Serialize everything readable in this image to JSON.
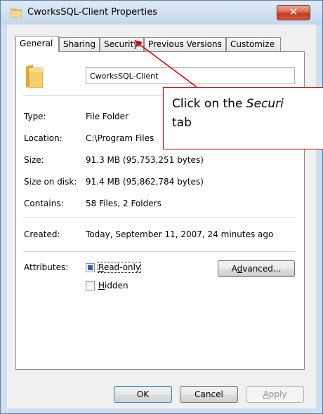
{
  "window": {
    "title": "CworksSQL-Client Properties",
    "close_glyph": "✕",
    "accent": "#c23a21"
  },
  "tabs": [
    {
      "label": "General"
    },
    {
      "label": "Sharing"
    },
    {
      "label": "Security"
    },
    {
      "label": "Previous Versions"
    },
    {
      "label": "Customize"
    }
  ],
  "general": {
    "folder_name": "CworksSQL-Client",
    "rows": [
      {
        "label": "Type:",
        "value": "File Folder"
      },
      {
        "label": "Location:",
        "value": "C:\\Program Files"
      },
      {
        "label": "Size:",
        "value": "91.3 MB (95,753,251 bytes)"
      },
      {
        "label": "Size on disk:",
        "value": "91.4 MB (95,862,784 bytes)"
      },
      {
        "label": "Contains:",
        "value": "58 Files, 2 Folders"
      }
    ],
    "created_label": "Created:",
    "created_value": "Today, September 11, 2007, 24 minutes ago",
    "attributes_label": "Attributes:",
    "readonly": {
      "label_first": "R",
      "label_rest": "ead-only",
      "state": "indeterminate"
    },
    "hidden": {
      "label_first": "H",
      "label_rest": "idden",
      "checked": false
    },
    "advanced": {
      "pre": "A",
      "underline": "d",
      "post": "vanced..."
    }
  },
  "buttons": {
    "ok": "OK",
    "cancel": "Cancel",
    "apply_first": "A",
    "apply_rest": "pply"
  },
  "callout": {
    "line1_prefix": "Click on the ",
    "line1_emph": "Securi",
    "line2": "tab",
    "border_color": "#d00000"
  }
}
